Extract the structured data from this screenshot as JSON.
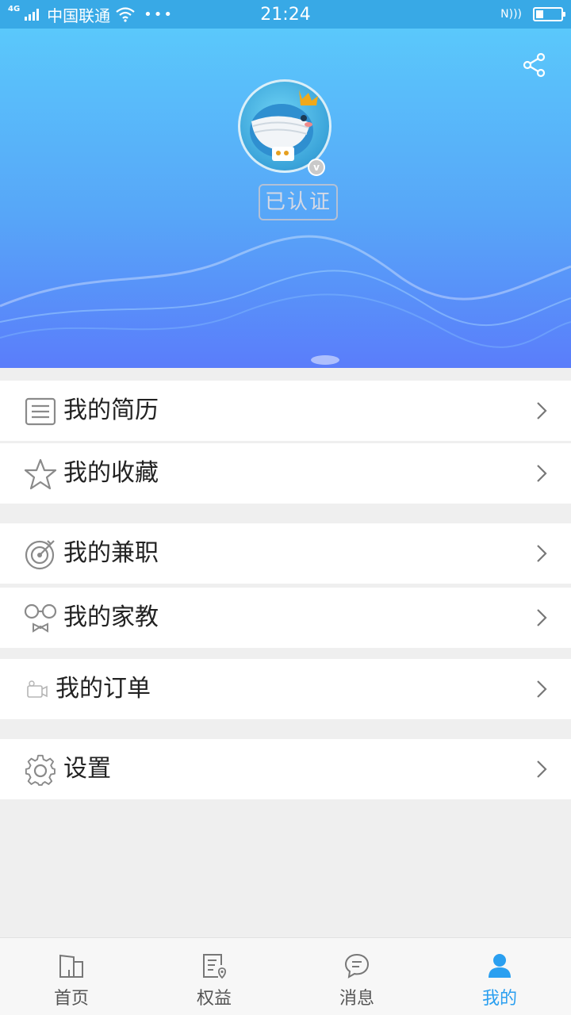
{
  "status_bar": {
    "network": "4G",
    "carrier": "中国联通",
    "dots": "•••",
    "time": "21:24",
    "nfc": "N)))",
    "battery_level": 0.3,
    "icons": [
      "signal-icon",
      "wifi-icon",
      "nfc-icon",
      "battery-icon"
    ]
  },
  "header": {
    "share_icon": "share-icon",
    "avatar": "whale-avatar",
    "v_badge": "v",
    "verified_label": "已认证"
  },
  "menu": [
    {
      "label": "我的简历",
      "icon": "resume-icon"
    },
    {
      "label": "我的收藏",
      "icon": "star-icon"
    },
    {
      "label": "我的兼职",
      "icon": "target-icon"
    },
    {
      "label": "我的家教",
      "icon": "glasses-bowtie-icon"
    },
    {
      "label": "我的订单",
      "icon": "camera-icon"
    },
    {
      "label": "设置",
      "icon": "gear-icon"
    }
  ],
  "tabs": [
    {
      "label": "首页",
      "icon": "home-icon",
      "active": false
    },
    {
      "label": "权益",
      "icon": "rights-icon",
      "active": false
    },
    {
      "label": "消息",
      "icon": "message-icon",
      "active": false
    },
    {
      "label": "我的",
      "icon": "person-icon",
      "active": true
    }
  ],
  "colors": {
    "status_bar": "#38a9e6",
    "header_top": "#5ac8fb",
    "header_bottom": "#5a7dfa",
    "accent": "#2a9ff0",
    "background": "#efefef"
  }
}
